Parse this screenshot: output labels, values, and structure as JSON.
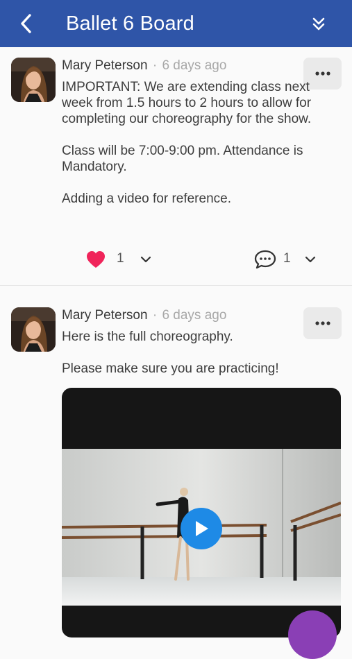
{
  "header": {
    "title": "Ballet 6 Board",
    "back_icon": "chevron-left-icon",
    "collapse_icon": "double-chevron-down-icon",
    "background_color": "#2f55a8"
  },
  "posts": [
    {
      "author": "Mary Peterson",
      "separator": "·",
      "time": "6 days ago",
      "paragraphs": [
        "IMPORTANT: We are extending class next week from 1.5 hours to 2 hours to allow for completing our choreography for the show.",
        "Class will be 7:00-9:00 pm. Attendance is Mandatory.",
        "Adding a video for reference."
      ],
      "likes": "1",
      "comments": "1",
      "like_color": "#f0245a"
    },
    {
      "author": "Mary Peterson",
      "separator": "·",
      "time": "6 days ago",
      "paragraphs": [
        "Here is the full choreography.",
        "Please make sure you are practicing!"
      ],
      "video_icon": "play-icon"
    }
  ]
}
